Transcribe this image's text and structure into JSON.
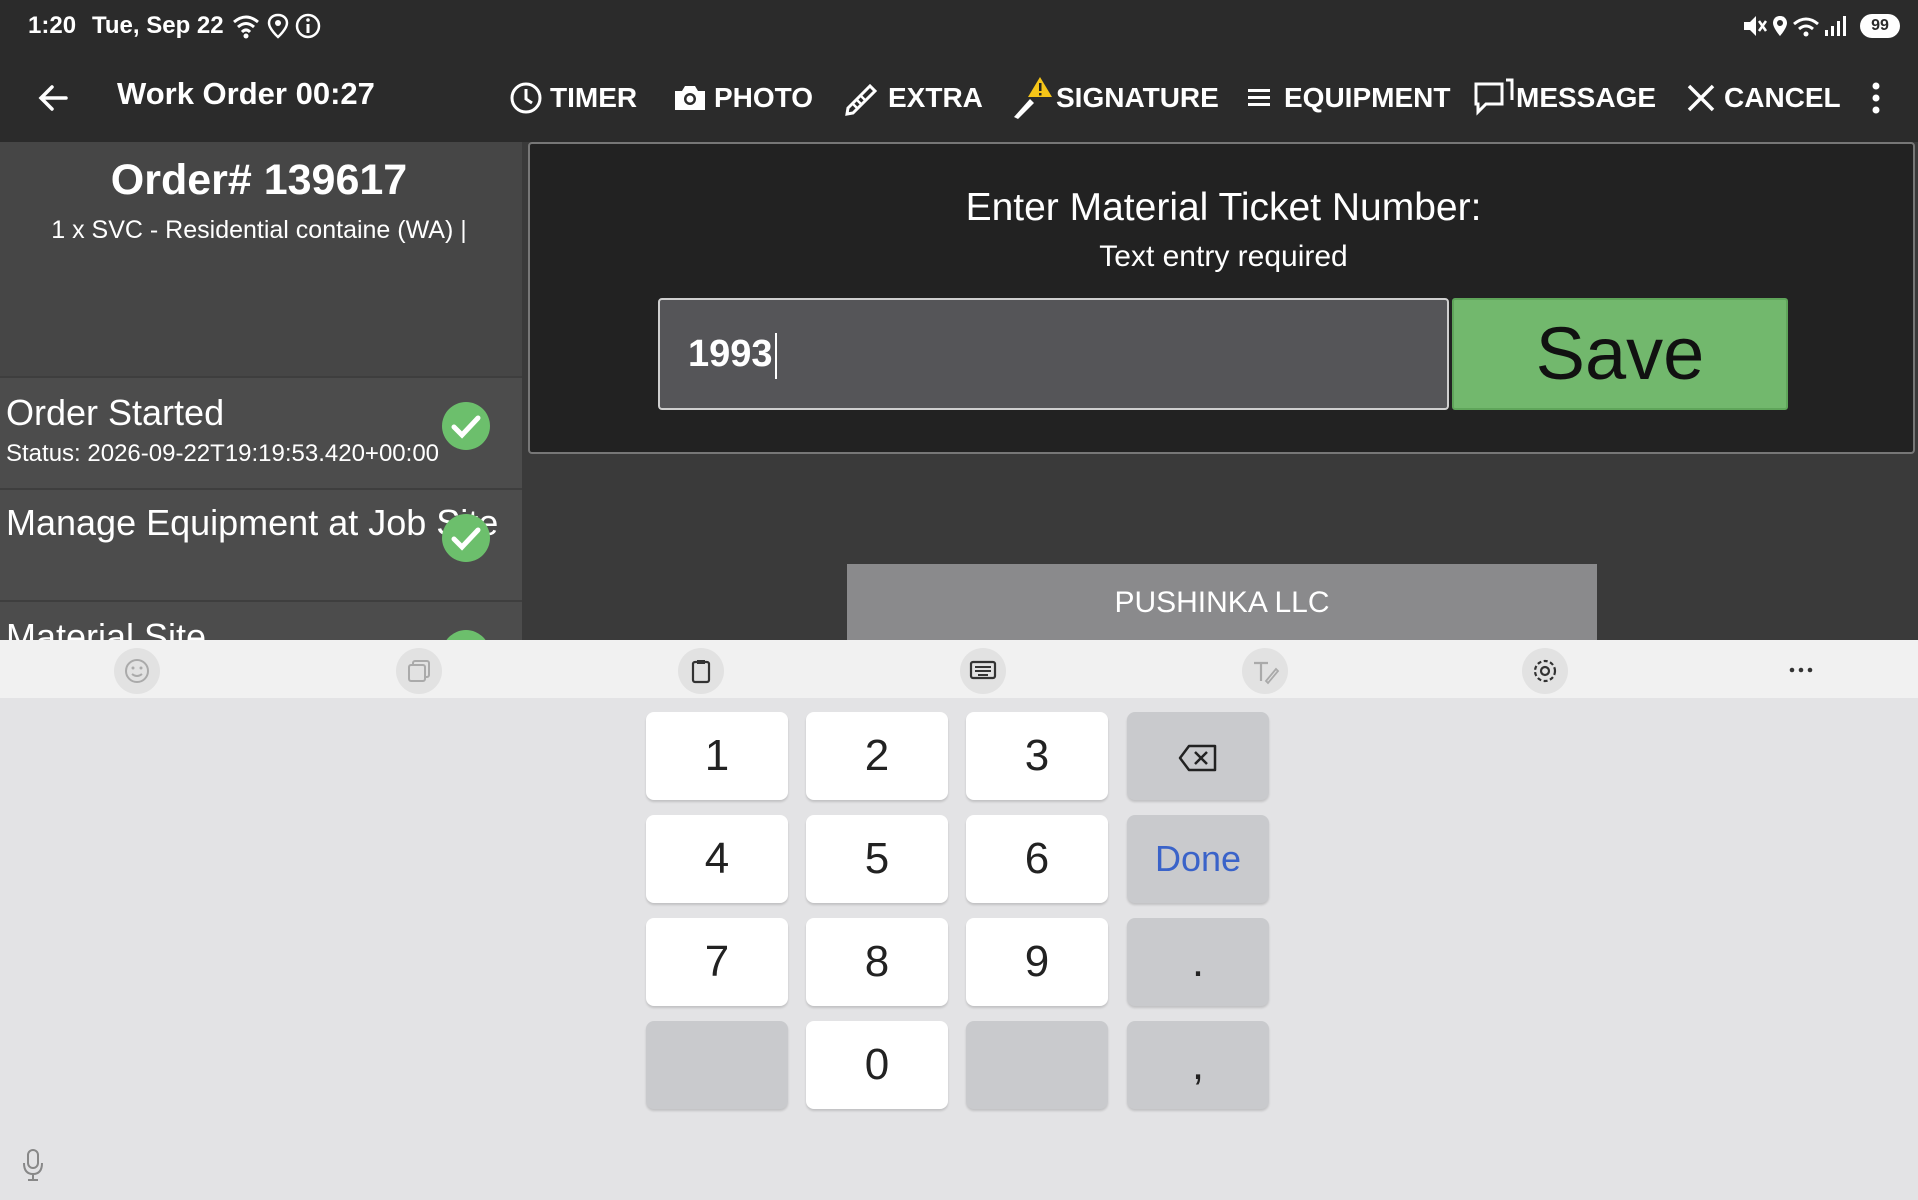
{
  "status_bar": {
    "time": "1:20",
    "date": "Tue, Sep 22",
    "battery": "99"
  },
  "app_bar": {
    "title": "Work Order 00:27",
    "actions": {
      "timer": "TIMER",
      "photo": "PHOTO",
      "extra": "EXTRA",
      "signature": "SIGNATURE",
      "equipment": "EQUIPMENT",
      "message": "MESSAGE",
      "cancel": "CANCEL"
    }
  },
  "order": {
    "number": "Order# 139617",
    "description": "1 x SVC - Residential containe (WA) |",
    "steps": [
      {
        "title": "Order Started",
        "status": "Status: 2026-09-22T19:19:53.420+00:00"
      },
      {
        "title": "Manage Equipment at Job Site"
      },
      {
        "title": "Material Site"
      }
    ]
  },
  "dialog": {
    "title": "Enter Material Ticket Number:",
    "subtitle": "Text entry required",
    "input_value": "1993",
    "save_label": "Save"
  },
  "company": {
    "name": "PUSHINKA LLC"
  },
  "keyboard": {
    "keys": [
      "1",
      "2",
      "3",
      "4",
      "5",
      "6",
      "7",
      "8",
      "9",
      "0"
    ],
    "done_label": "Done",
    "period": ".",
    "comma": ","
  },
  "colors": {
    "accent_green": "#72b86d",
    "check_green": "#6cbf6c",
    "warning_yellow": "#f5c518",
    "done_blue": "#3a63c9"
  }
}
